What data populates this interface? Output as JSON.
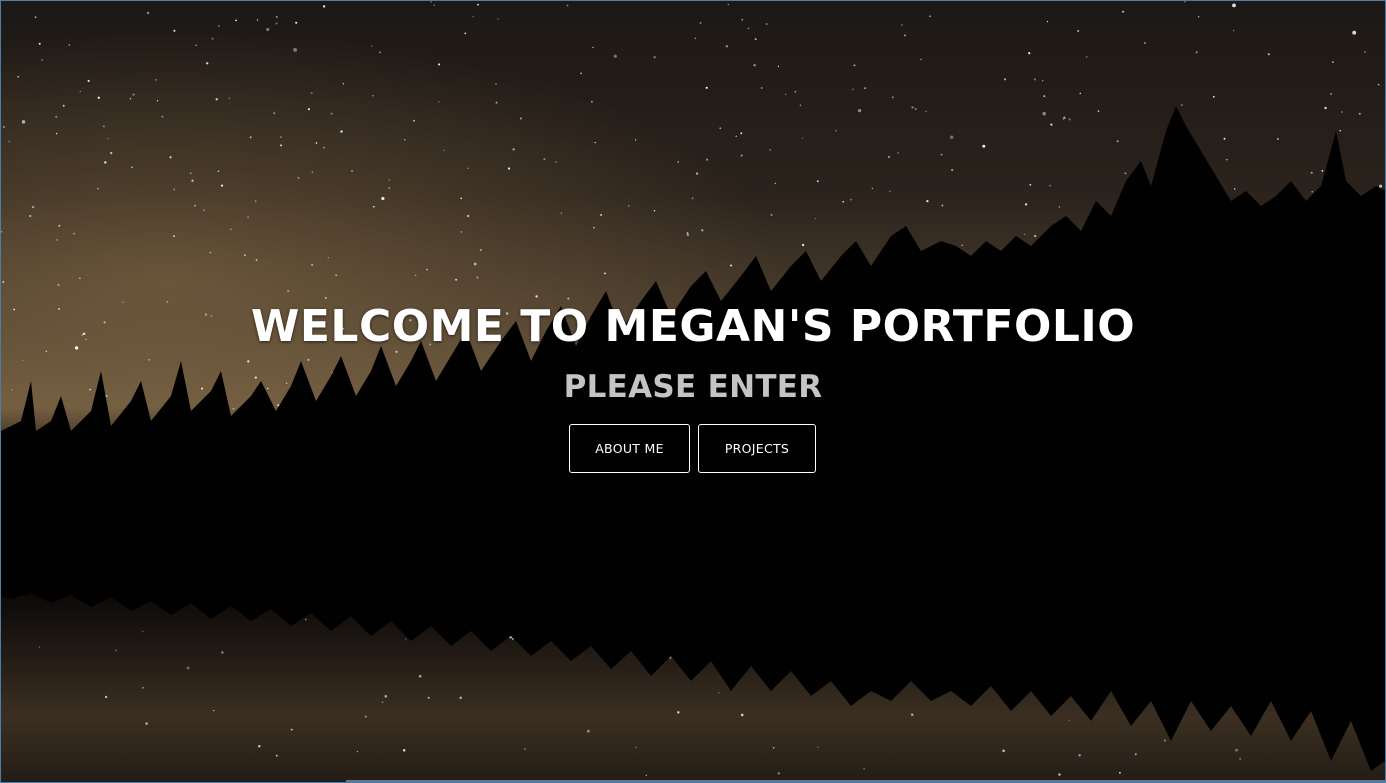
{
  "hero": {
    "title": "WELCOME TO MEGAN'S PORTFOLIO",
    "subtitle": "PLEASE ENTER"
  },
  "nav": {
    "about_label": "ABOUT ME",
    "projects_label": "PROJECTS"
  },
  "colors": {
    "title": "#ffffff",
    "subtitle": "#c4c4c4",
    "button_border": "#ffffff",
    "sky_top": "#1b1714",
    "sky_glow": "#6e5a3f",
    "silhouette": "#020102"
  },
  "background": {
    "scene": "starry night sky over forest lake with reflection"
  }
}
